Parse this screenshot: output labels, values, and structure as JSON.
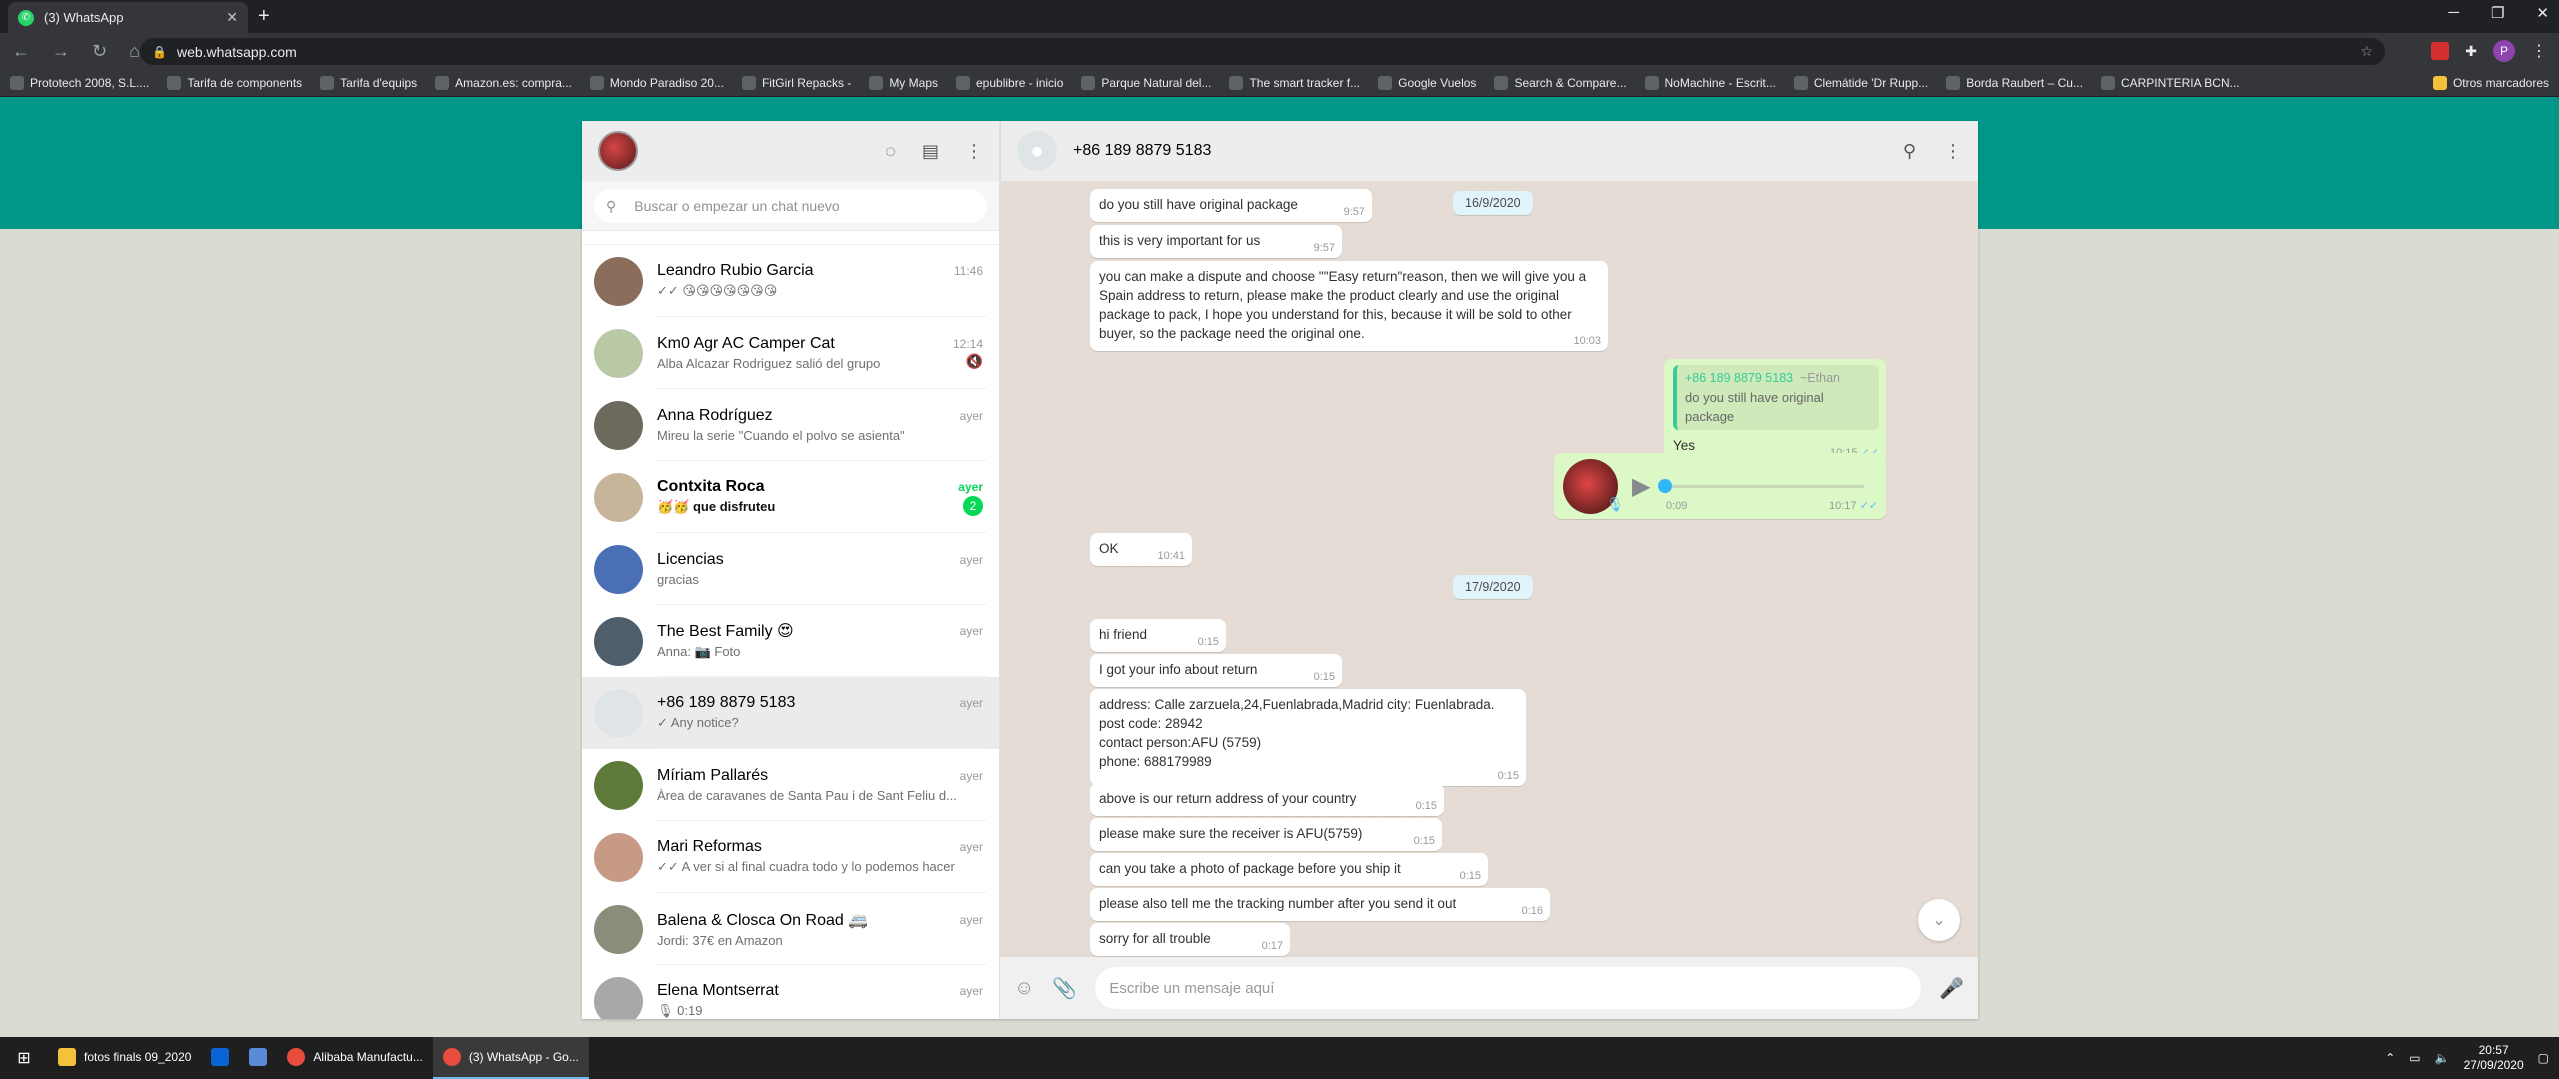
{
  "browser": {
    "tab_title": "(3) WhatsApp",
    "url": "web.whatsapp.com",
    "profile_initial": "P",
    "bookmarks": [
      "Prototech 2008, S.L....",
      "Tarifa de components",
      "Tarifa d'equips",
      "Amazon.es: compra...",
      "Mondo Paradiso 20...",
      "FitGirl Repacks -",
      "My Maps",
      "epublibre - inicio",
      "Parque Natural del...",
      "The smart tracker f...",
      "Google Vuelos",
      "Search & Compare...",
      "NoMachine - Escrit...",
      "Clemátide 'Dr Rupp...",
      "Borda Raubert – Cu...",
      "CARPINTERIA BCN..."
    ],
    "other_bookmarks": "Otros marcadores"
  },
  "sidebar": {
    "search_placeholder": "Buscar o empezar un chat nuevo",
    "chats": [
      {
        "name": "Leandro Rubio Garcia",
        "time": "11:46",
        "last": "✓✓ 😘😘😘😘😘😘😘",
        "color": "#8a6d5b"
      },
      {
        "name": "Km0 Agr AC Camper Cat",
        "time": "12:14",
        "last": "Alba Alcazar Rodriguez salió del grupo",
        "color": "#b9c9a6",
        "muted": true
      },
      {
        "name": "Anna Rodríguez",
        "time": "ayer",
        "last": "Mireu la serie \"Cuando el polvo se asienta\"",
        "color": "#6c6a5d"
      },
      {
        "name": "Contxita Roca",
        "time": "ayer",
        "last": "🥳🥳 que disfruteu",
        "color": "#c6b59a",
        "unread": "2"
      },
      {
        "name": "Licencias",
        "time": "ayer",
        "last": "gracias",
        "color": "#4b6fb5"
      },
      {
        "name": "The Best Family 😍",
        "time": "ayer",
        "last": "Anna: 📷 Foto",
        "color": "#4f5e6b"
      },
      {
        "name": "+86 189 8879 5183",
        "time": "ayer",
        "last": "✓ Any notice?",
        "color": "#dfe5e7",
        "active": true
      },
      {
        "name": "Míriam Pallarés",
        "time": "ayer",
        "last": "Àrea de caravanes de Santa Pau i de Sant Feliu d...",
        "color": "#5d7a3b"
      },
      {
        "name": "Mari Reformas",
        "time": "ayer",
        "last": "✓✓ A ver si al final cuadra todo y lo podemos hacer",
        "color": "#c79a86"
      },
      {
        "name": "Balena & Closca On Road 🚐",
        "time": "ayer",
        "last": "Jordi: 37€ en Amazon",
        "color": "#8c8c7a"
      },
      {
        "name": "Elena Montserrat",
        "time": "ayer",
        "last": "🎙 0:19",
        "color": "#a8a8a8"
      }
    ]
  },
  "conversation": {
    "contact": "+86 189 8879 5183",
    "composer_placeholder": "Escribe un mensaje aquí",
    "messages": {
      "m1": {
        "text": "do you still have original package",
        "time": "9:57"
      },
      "d1": "16/9/2020",
      "m2": {
        "text": "this is very important for us",
        "time": "9:57"
      },
      "m3": {
        "text": "you can make a dispute and choose \"\"Easy return\"reason, then we will give you a Spain address to return, please make the product clearly and use the original package to pack, I hope you understand for this, because it will be sold to other buyer, so the package need the original one.",
        "time": "10:03"
      },
      "q1": {
        "quote_author": "+86 189 8879 5183",
        "quote_alias": "~Ethan",
        "quote_text": "do you still have original package",
        "text": "Yes",
        "time": "10:15"
      },
      "v1": {
        "duration": "0:09",
        "time": "10:17"
      },
      "m4": {
        "text": "OK",
        "time": "10:41"
      },
      "d2": "17/9/2020",
      "m5": {
        "text": "hi friend",
        "time": "0:15"
      },
      "m6": {
        "text": "I got your info about return",
        "time": "0:15"
      },
      "m7": {
        "line1": "address:  Calle zarzuela,24,Fuenlabrada,Madrid  city:  Fuenlabrada.",
        "line2": "post code:    28942",
        "line3": "contact person:AFU  (5759)",
        "line4": "phone:   688179989",
        "time": "0:15"
      },
      "m8": {
        "text": "above is our return address of your country",
        "time": "0:15"
      },
      "m9": {
        "text": "please make sure the receiver is AFU(5759)",
        "time": "0:15"
      },
      "m10": {
        "text": "can you take a photo of package before you ship it",
        "time": "0:15"
      },
      "m11": {
        "text": "please also tell me the tracking number after you send it out",
        "time": "0:16"
      },
      "m12": {
        "text": "sorry for all trouble",
        "time": "0:17"
      }
    }
  },
  "taskbar": {
    "items": [
      "fotos finals 09_2020",
      "Alibaba Manufactu...",
      "(3) WhatsApp - Go..."
    ],
    "time": "20:57",
    "date": "27/09/2020"
  },
  "colors": {
    "teal_band": "#009688",
    "outgoing": "#dcf8c6",
    "unread": "#06d755"
  }
}
